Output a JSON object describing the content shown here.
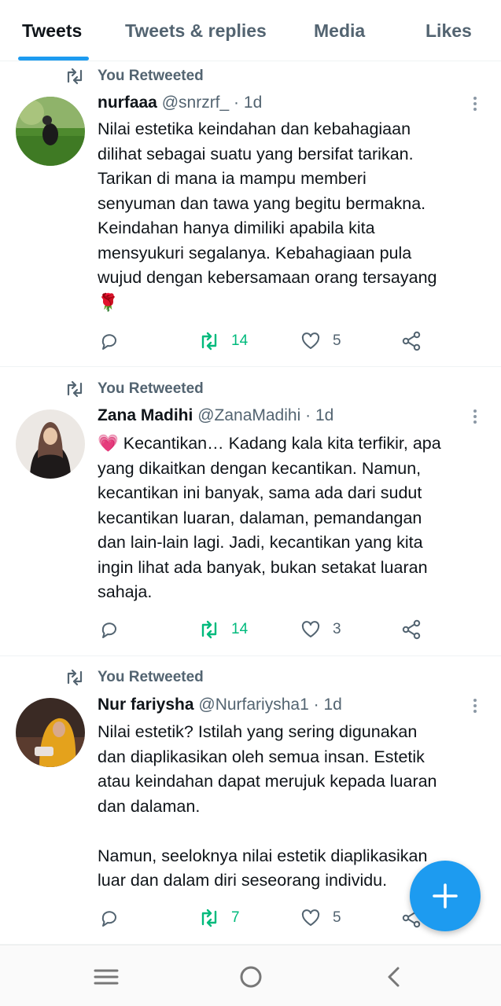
{
  "tabs": [
    {
      "label": "Tweets",
      "active": true
    },
    {
      "label": "Tweets & replies",
      "active": false
    },
    {
      "label": "Media",
      "active": false
    },
    {
      "label": "Likes",
      "active": false
    }
  ],
  "colors": {
    "accent": "#1d9bf0",
    "retweet_green": "#00ba7c",
    "muted": "#536471",
    "text": "#0f1419"
  },
  "tweets": [
    {
      "retweeted_label": "You Retweeted",
      "name": "nurfaaa",
      "handle": "@snrzrf_",
      "time": "1d",
      "lines": [
        "Nilai estetika keindahan dan kebahagiaan",
        "dilihat sebagai suatu yang bersifat tarikan.",
        "Tarikan di mana ia mampu memberi",
        "senyuman dan tawa yang begitu bermakna.",
        "Keindahan hanya dimiliki apabila kita",
        "mensyukuri segalanya. Kebahagiaan pula",
        "wujud dengan kebersamaan  orang tersayang",
        "🌹"
      ],
      "retweets": "14",
      "likes": "5"
    },
    {
      "retweeted_label": "You Retweeted",
      "name": "Zana Madihi",
      "handle": "@ZanaMadihi",
      "time": "1d",
      "lines": [
        "💗 Kecantikan… Kadang kala kita terfikir, apa",
        "yang dikaitkan dengan kecantikan. Namun,",
        "kecantikan ini banyak, sama ada dari sudut",
        "kecantikan luaran, dalaman, pemandangan",
        "dan lain-lain lagi. Jadi, kecantikan yang kita",
        "ingin lihat ada banyak, bukan setakat luaran",
        "sahaja."
      ],
      "retweets": "14",
      "likes": "3"
    },
    {
      "retweeted_label": "You Retweeted",
      "name": "Nur fariysha",
      "handle": "@Nurfariysha1",
      "time": "1d",
      "lines": [
        "Nilai estetik? Istilah yang sering digunakan",
        "dan diaplikasikan oleh semua insan. Estetik",
        "atau keindahan dapat merujuk kepada luaran",
        "dan dalaman.",
        "",
        "Namun, seeloknya nilai estetik diaplikasikan",
        "luar dan dalam diri seseorang individu."
      ],
      "retweets": "7",
      "likes": "5"
    }
  ],
  "icons": {
    "retweeted": "retweet-icon",
    "reply": "reply-icon",
    "retweet": "retweet-icon",
    "like": "heart-icon",
    "share": "share-icon",
    "more": "more-vertical-icon",
    "compose": "plus-icon",
    "nav_menu": "menu-icon",
    "nav_home": "home-circle-icon",
    "nav_back": "back-icon"
  }
}
